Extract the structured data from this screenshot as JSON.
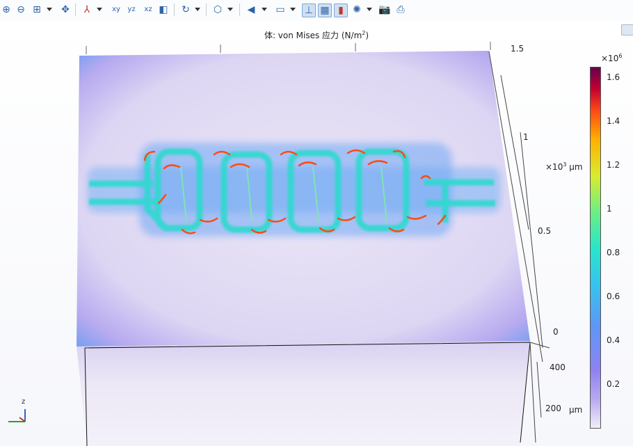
{
  "toolbar": {
    "icons": [
      "zoom-in",
      "zoom-out",
      "zoom-box",
      "zoom-extents",
      "axis-orientation",
      "view-xy",
      "view-yz",
      "view-xz",
      "scene-light",
      "rotate",
      "render-mode",
      "transparency",
      "lights",
      "show-axis",
      "show-grid",
      "colorbar-toggle",
      "camera-settings",
      "screenshot",
      "print"
    ]
  },
  "plot": {
    "title_prefix": "体: von Mises 应力 (N/m",
    "title_exp": "2",
    "title_suffix": ")"
  },
  "axes": {
    "right_ticks": [
      "1.5",
      "1",
      "0.5",
      "0"
    ],
    "right_scale_prefix": "×10",
    "right_scale_exp": "3",
    "right_unit": "μm",
    "bottom_ticks": [
      "400",
      "200"
    ],
    "bottom_unit": "μm",
    "triad_z": "z"
  },
  "colorbar": {
    "exp_prefix": "×10",
    "exp": "6",
    "ticks": [
      "1.6",
      "1.4",
      "1.2",
      "1",
      "0.8",
      "0.6",
      "0.4",
      "0.2"
    ],
    "min": 0,
    "max": 1.65
  },
  "colors": {
    "face_edge": "#7b9ff0",
    "face_fill": "#e8e2f5",
    "channel_high": "#28e6c8",
    "hotspot": "#ff4a14"
  }
}
